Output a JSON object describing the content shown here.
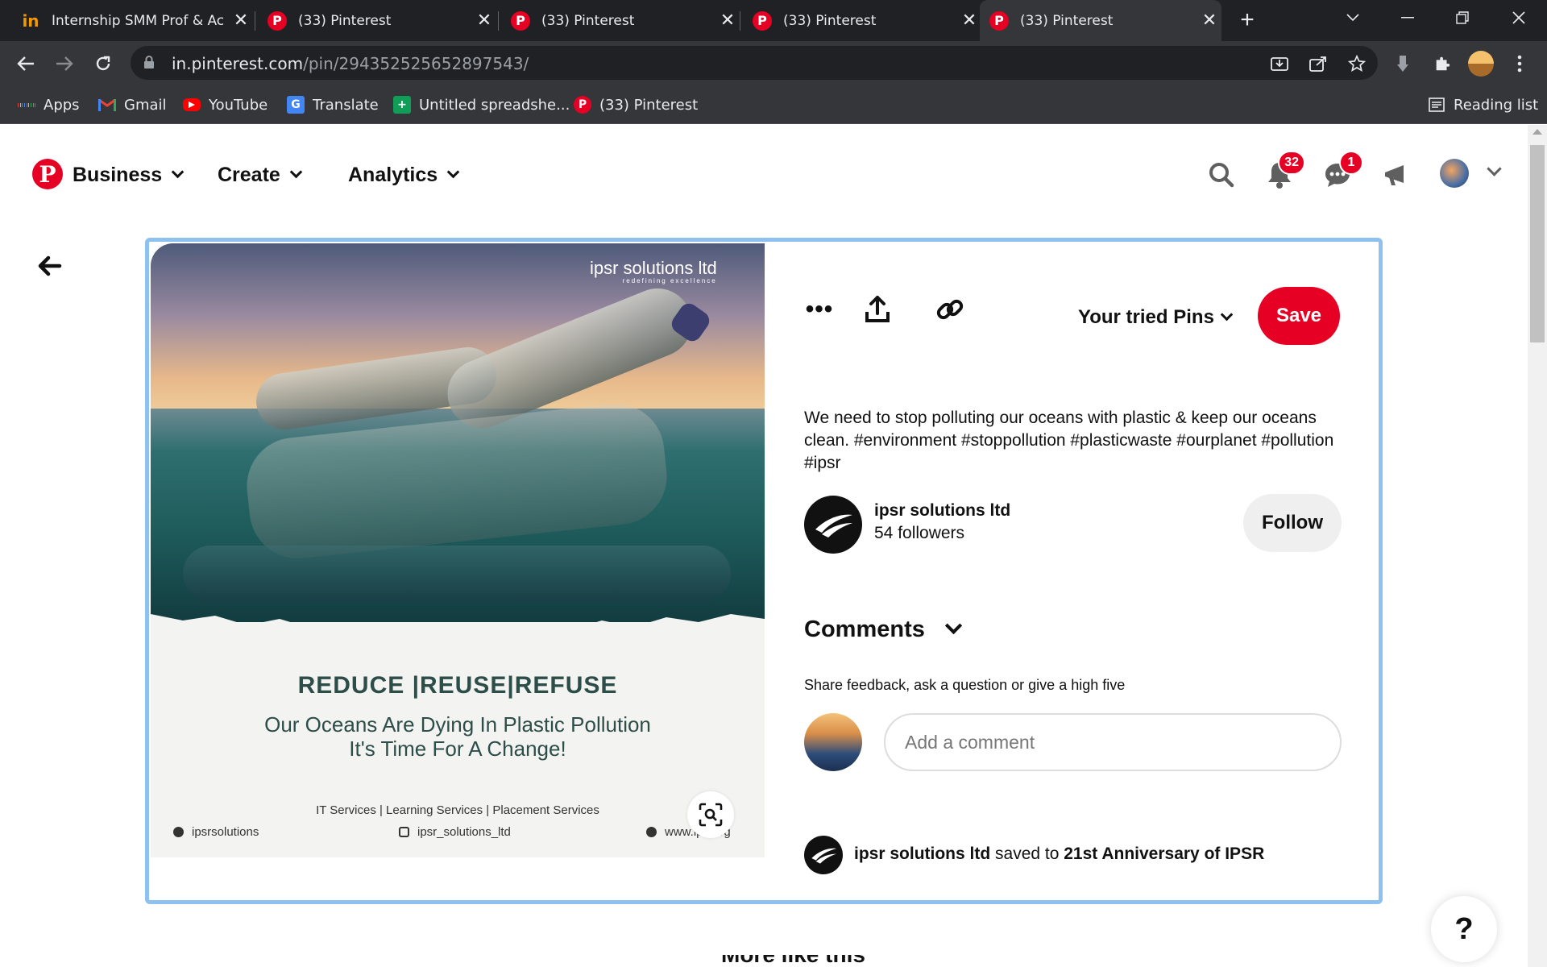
{
  "browser": {
    "tabs": [
      {
        "title": "Internship SMM Prof & Ac",
        "favicon": "in-favicon-icon",
        "active": false
      },
      {
        "title": "(33) Pinterest",
        "favicon": "pinterest-icon",
        "active": false
      },
      {
        "title": "(33) Pinterest",
        "favicon": "pinterest-icon",
        "active": false
      },
      {
        "title": "(33) Pinterest",
        "favicon": "pinterest-icon",
        "active": false
      },
      {
        "title": "(33) Pinterest",
        "favicon": "pinterest-icon",
        "active": true
      }
    ],
    "url_host": "in.pinterest.com",
    "url_path": "/pin/294352525652897543/",
    "bookmarks": [
      {
        "label": "Apps",
        "icon": "apps-grid-icon"
      },
      {
        "label": "Gmail",
        "icon": "gmail-icon"
      },
      {
        "label": "YouTube",
        "icon": "youtube-icon"
      },
      {
        "label": "Translate",
        "icon": "translate-icon"
      },
      {
        "label": "Untitled spreadshe...",
        "icon": "sheets-icon"
      },
      {
        "label": "(33) Pinterest",
        "icon": "pinterest-icon"
      }
    ],
    "reading_list": "Reading list"
  },
  "header": {
    "nav": [
      "Business",
      "Create",
      "Analytics"
    ],
    "notifications_count": "32",
    "messages_count": "1"
  },
  "pin": {
    "image": {
      "watermark_brand": "ipsr solutions ltd",
      "watermark_tagline": "redefining excellence",
      "slogan": "REDUCE |REUSE|REFUSE",
      "line1": "Our Oceans Are Dying In Plastic Pollution",
      "line2": "It's Time For A Change!",
      "services": "IT Services | Learning Services | Placement Services",
      "facebook": "ipsrsolutions",
      "instagram": "ipsr_solutions_ltd",
      "website": "www.ip...org"
    },
    "board_select": "Your tried Pins",
    "save_label": "Save",
    "description": "We need to stop polluting our oceans with plastic & keep our oceans clean. #environment #stoppollution #plasticwaste #ourplanet #pollution #ipsr",
    "creator_name": "ipsr solutions ltd",
    "creator_followers": "54 followers",
    "follow_label": "Follow",
    "comments_title": "Comments",
    "comments_hint": "Share feedback, ask a question or give a high five",
    "comment_placeholder": "Add a comment",
    "saved_by": "ipsr solutions ltd",
    "saved_to_text": "saved to",
    "saved_board": "21st Anniversary of IPSR"
  },
  "help_label": "?",
  "more_like_this": "More like this",
  "colors": {
    "pinterest_red": "#e60023",
    "card_outline": "#8fc1f0"
  }
}
